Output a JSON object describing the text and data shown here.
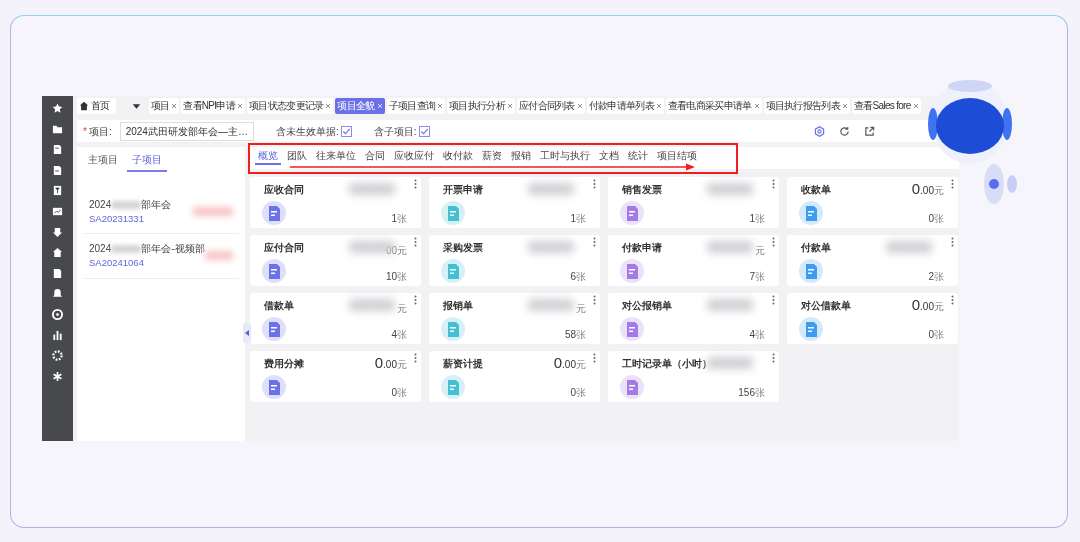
{
  "tabs": [
    {
      "label": "首页",
      "kind": "home",
      "selected": false
    },
    {
      "label": "项目",
      "kind": "tab",
      "selected": false
    },
    {
      "label": "查看NPI申请",
      "kind": "tab",
      "selected": false
    },
    {
      "label": "项目状态变更记录",
      "kind": "tab",
      "selected": false
    },
    {
      "label": "项目全貌",
      "kind": "tab",
      "selected": true
    },
    {
      "label": "子项目查询",
      "kind": "tab",
      "selected": false
    },
    {
      "label": "项目执行分析",
      "kind": "tab",
      "selected": false
    },
    {
      "label": "应付合同列表",
      "kind": "tab",
      "selected": false
    },
    {
      "label": "付款申请单列表",
      "kind": "tab",
      "selected": false
    },
    {
      "label": "查看电商采买申请单",
      "kind": "tab",
      "selected": false
    },
    {
      "label": "项目执行报告列表",
      "kind": "tab",
      "selected": false
    },
    {
      "label": "查看Sales fore",
      "kind": "tab",
      "selected": false
    }
  ],
  "filter": {
    "required_mark": "*",
    "project_label": "项目:",
    "project_value": "2024武田研发部年会—主…",
    "checks": [
      {
        "label": "含未生效单据:",
        "checked": true
      },
      {
        "label": "含子项目:",
        "checked": true
      }
    ]
  },
  "left_panel": {
    "tabs": [
      {
        "label": "主项目",
        "selected": false
      },
      {
        "label": "子项目",
        "selected": true
      }
    ],
    "items": [
      {
        "name_start": "2024",
        "name_end": "部年会",
        "code": "SA20231331"
      },
      {
        "name_start": "2024",
        "name_end": "部年会-视频部",
        "code": "SA20241064"
      }
    ]
  },
  "sub_tabs": [
    {
      "label": "概览",
      "selected": true
    },
    {
      "label": "团队",
      "selected": false
    },
    {
      "label": "往来单位",
      "selected": false
    },
    {
      "label": "合同",
      "selected": false
    },
    {
      "label": "应收应付",
      "selected": false
    },
    {
      "label": "收付款",
      "selected": false
    },
    {
      "label": "薪资",
      "selected": false
    },
    {
      "label": "报销",
      "selected": false
    },
    {
      "label": "工时与执行",
      "selected": false
    },
    {
      "label": "文档",
      "selected": false
    },
    {
      "label": "统计",
      "selected": false
    },
    {
      "label": "项目结项",
      "selected": false
    }
  ],
  "cards": [
    {
      "title": "应收合同",
      "color": "#6b72e8",
      "count": "1",
      "unit": "张"
    },
    {
      "title": "开票申请",
      "color": "#45c0d3",
      "count": "1",
      "unit": "张"
    },
    {
      "title": "销售发票",
      "color": "#a27be6",
      "count": "1",
      "unit": "张"
    },
    {
      "title": "收款单",
      "color": "#3b9cf0",
      "amount": "0.00",
      "currency": "元",
      "count": "0",
      "unit": "张"
    },
    {
      "title": "应付合同",
      "color": "#6b72e8",
      "amount_fragment": "00元",
      "count": "10",
      "unit": "张"
    },
    {
      "title": "采购发票",
      "color": "#45c0d3",
      "count": "6",
      "unit": "张"
    },
    {
      "title": "付款申请",
      "color": "#a27be6",
      "amount_fragment": "元",
      "count": "7",
      "unit": "张"
    },
    {
      "title": "付款单",
      "color": "#3b9cf0",
      "count": "2",
      "unit": "张"
    },
    {
      "title": "借款单",
      "color": "#6b72e8",
      "amount_fragment": "元",
      "count": "4",
      "unit": "张"
    },
    {
      "title": "报销单",
      "color": "#45c0d3",
      "amount_fragment": "元",
      "count": "58",
      "unit": "张"
    },
    {
      "title": "对公报销单",
      "color": "#a27be6",
      "count": "4",
      "unit": "张"
    },
    {
      "title": "对公借款单",
      "color": "#3b9cf0",
      "amount": "0.00",
      "currency": "元",
      "count": "0",
      "unit": "张"
    },
    {
      "title": "费用分摊",
      "color": "#6b72e8",
      "amount": "0.00",
      "currency": "元",
      "count": "0",
      "unit": "张"
    },
    {
      "title": "薪资计提",
      "color": "#45c0d3",
      "amount": "0.00",
      "currency": "元",
      "count": "0",
      "unit": "张"
    },
    {
      "title": "工时记录单（小时）",
      "color": "#a27be6",
      "count": "156",
      "unit": "张"
    }
  ]
}
